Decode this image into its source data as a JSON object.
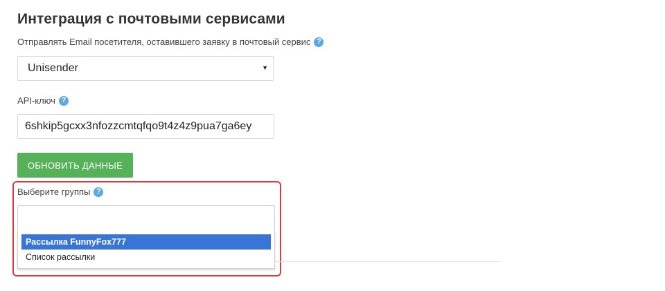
{
  "section": {
    "title": "Интеграция с почтовыми сервисами"
  },
  "provider": {
    "label": "Отправлять Email посетителя, оставившего заявку в почтовый сервис",
    "value": "Unisender",
    "help_icon": "question-circle-icon",
    "caret_icon": "caret-down-icon"
  },
  "api": {
    "label": "API-ключ",
    "value": "6shkip5gcxx3nfozzcmtqfqo9t4z4z9pua7ga6ey",
    "help_icon": "question-circle-icon"
  },
  "update_button": {
    "label": "ОБНОВИТЬ ДАННЫЕ",
    "color": "#55b259"
  },
  "groups": {
    "label": "Выберите группы",
    "help_icon": "question-circle-icon",
    "input_value": "",
    "options": [
      {
        "label": "Рассылка FunnyFox777",
        "selected": true
      },
      {
        "label": "Список рассылки",
        "selected": false
      }
    ]
  },
  "colors": {
    "help_icon": "#5aaae0",
    "highlight_border": "#e0393e",
    "selected_option": "#3875d7"
  }
}
